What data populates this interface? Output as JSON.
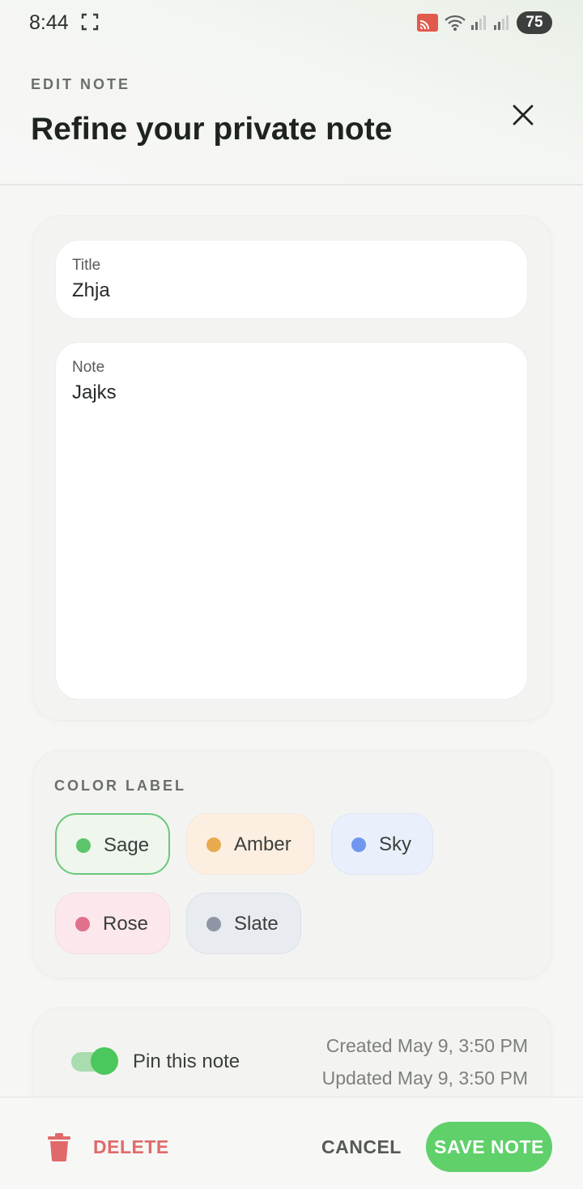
{
  "status_bar": {
    "time": "8:44",
    "battery": "75"
  },
  "header": {
    "eyebrow": "EDIT NOTE",
    "title": "Refine your private note"
  },
  "editor": {
    "title_label": "Title",
    "title_value": "Zhja",
    "note_label": "Note",
    "note_value": "Jajks"
  },
  "color_label": {
    "heading": "COLOR LABEL",
    "selected": "Sage",
    "options": [
      {
        "label": "Sage",
        "color": "#5cc46b"
      },
      {
        "label": "Amber",
        "color": "#e9a94f"
      },
      {
        "label": "Sky",
        "color": "#6f97ef"
      },
      {
        "label": "Rose",
        "color": "#e0708c"
      },
      {
        "label": "Slate",
        "color": "#8e96a6"
      }
    ]
  },
  "pin": {
    "label": "Pin this note",
    "enabled": true,
    "created": "Created May 9, 3:50 PM",
    "updated": "Updated May 9, 3:50 PM"
  },
  "actions": {
    "delete": "DELETE",
    "cancel": "CANCEL",
    "save": "SAVE NOTE"
  },
  "colors": {
    "accent": "#5fd06a",
    "danger": "#e06a6a"
  }
}
